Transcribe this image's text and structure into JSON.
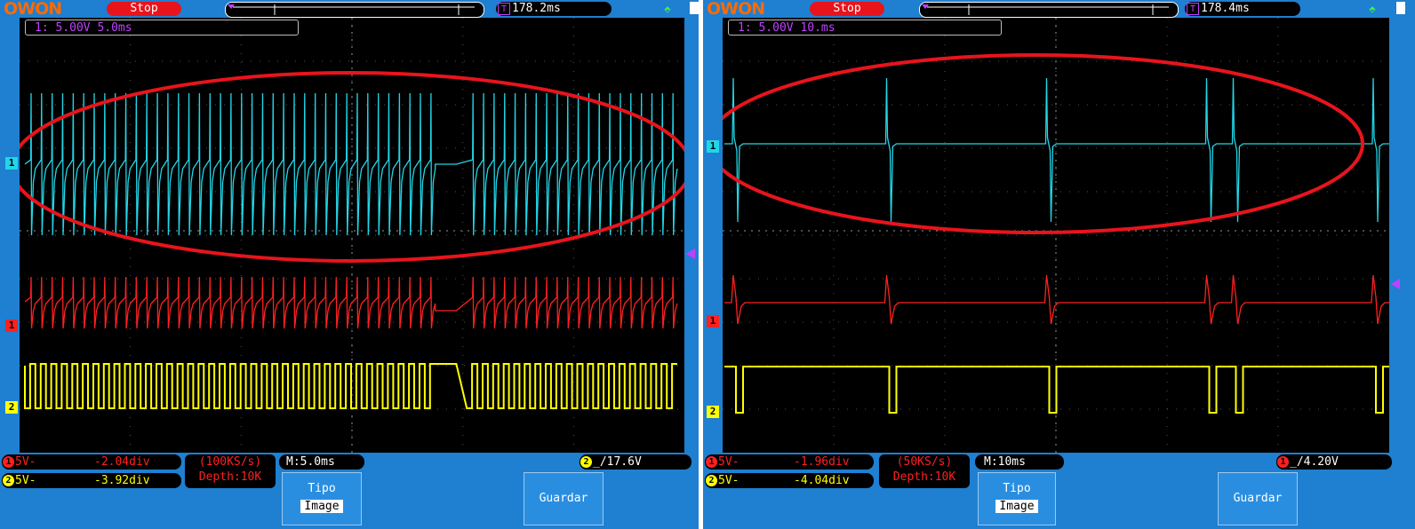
{
  "left": {
    "brand": "OWON",
    "status": "Stop",
    "trigger_time": "178.2ms",
    "channel_info": "1: 5.00V 5.0ms",
    "markers": {
      "ch1": "1",
      "ch2": "1",
      "ch3": "2"
    },
    "ch1_offset": "5V-",
    "ch1_pos": "-2.04div",
    "ch2_offset": "5V-",
    "ch2_pos": "-3.92div",
    "sample_rate": "(100KS/s)",
    "depth": "Depth:10K",
    "timebase": "M:5.0ms",
    "trigger_channel": "2",
    "trigger_level": "17.6V",
    "menu_title": "Tipo",
    "menu_value": "Image",
    "save_label": "Guardar"
  },
  "right": {
    "brand": "OWON",
    "status": "Stop",
    "trigger_time": "178.4ms",
    "channel_info": "1: 5.00V 10.ms",
    "markers": {
      "ch1": "1",
      "ch2": "1",
      "ch3": "2"
    },
    "ch1_offset": "5V-",
    "ch1_pos": "-1.96div",
    "ch2_offset": "5V-",
    "ch2_pos": "-4.04div",
    "sample_rate": "(50KS/s)",
    "depth": "Depth:10K",
    "timebase": "M:10ms",
    "trigger_channel": "1",
    "trigger_level": "4.20V",
    "menu_title": "Tipo",
    "menu_value": "Image",
    "save_label": "Guardar"
  },
  "colors": {
    "cyan": "#21d6e8",
    "red": "#ff2020",
    "yellow": "#ffff00",
    "purple": "#c040ff",
    "annotation": "#e8141c"
  },
  "waveforms": {
    "left": {
      "periods_ch1": 62,
      "pulse_count_ch3": 62,
      "gap_region": [
        0.61,
        0.66
      ]
    },
    "right": {
      "spike_positions": [
        0.02,
        0.25,
        0.49,
        0.73,
        0.77,
        0.98
      ]
    }
  }
}
